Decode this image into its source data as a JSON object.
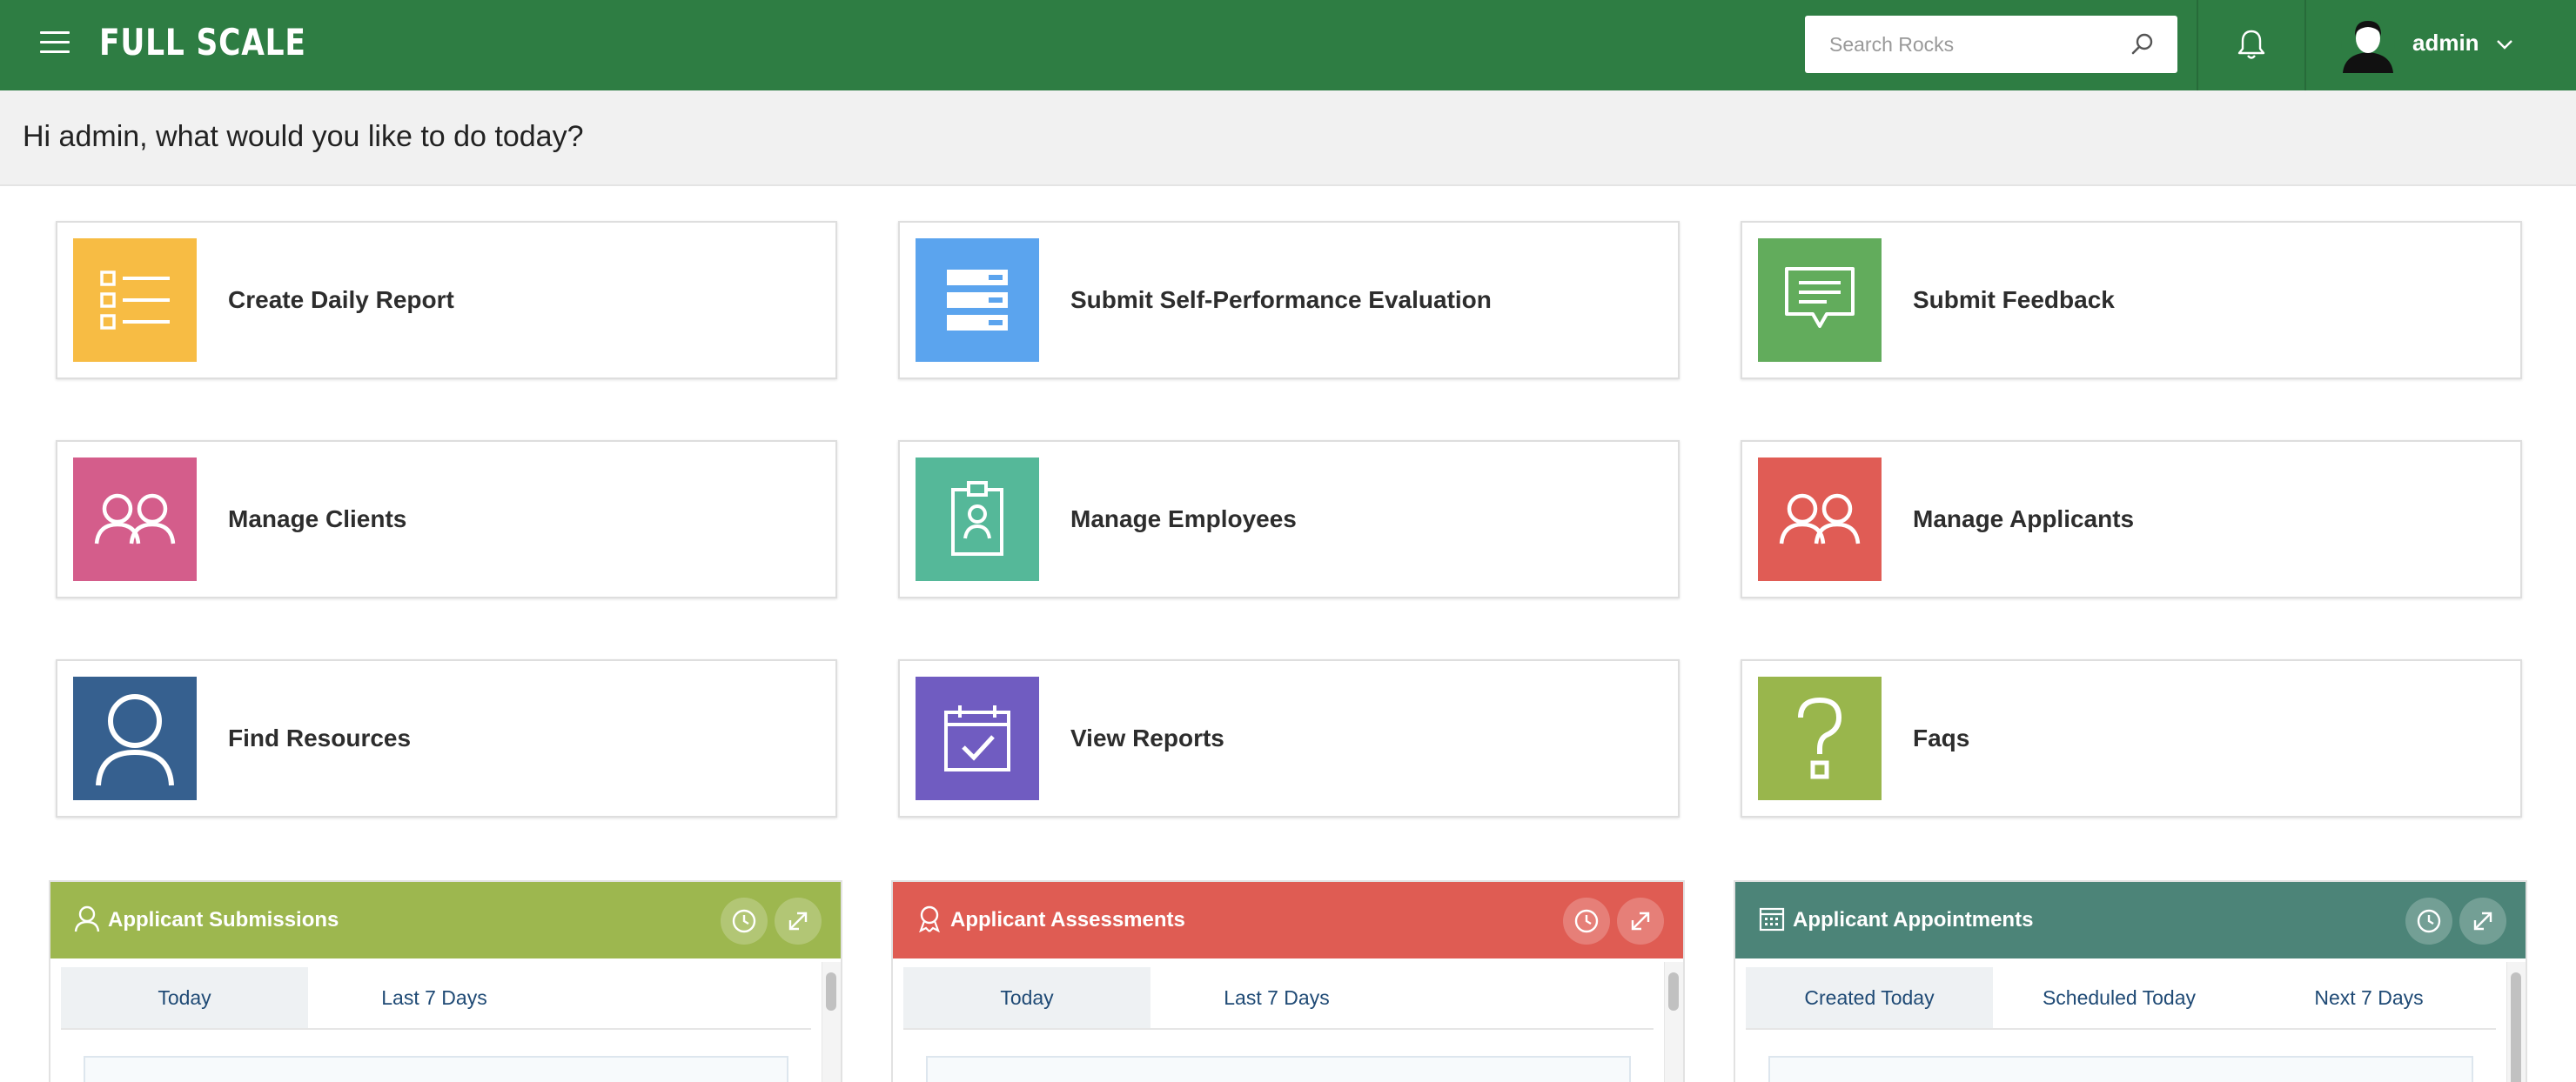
{
  "header": {
    "logo": "FULL SCALE",
    "search_placeholder": "Search Rocks",
    "user_name": "admin",
    "icons": {
      "menu": "hamburger-icon",
      "search": "search-icon",
      "notifications": "bell-icon",
      "account": "chevron-down-icon"
    }
  },
  "greeting": "Hi admin, what would you like to do today?",
  "cards": [
    {
      "label": "Create Daily Report",
      "color": "#f7bc44",
      "icon": "list-icon"
    },
    {
      "label": "Submit Self-Performance Evaluation",
      "color": "#5ba4ee",
      "icon": "form-icon"
    },
    {
      "label": "Submit Feedback",
      "color": "#62ac5c",
      "icon": "chat-icon"
    },
    {
      "label": "Manage Clients",
      "color": "#d45d8b",
      "icon": "users-icon"
    },
    {
      "label": "Manage Employees",
      "color": "#55b899",
      "icon": "badge-icon"
    },
    {
      "label": "Manage Applicants",
      "color": "#e05c55",
      "icon": "users-icon"
    },
    {
      "label": "Find Resources",
      "color": "#36608f",
      "icon": "person-icon"
    },
    {
      "label": "View Reports",
      "color": "#705cc1",
      "icon": "calendar-check-icon"
    },
    {
      "label": "Faqs",
      "color": "#99b64c",
      "icon": "question-icon"
    }
  ],
  "widgets": [
    {
      "title": "Applicant Submissions",
      "color": "#9db74f",
      "icon": "person-icon",
      "tabs": [
        "Today",
        "Last 7 Days"
      ],
      "active_tab": "Today"
    },
    {
      "title": "Applicant Assessments",
      "color": "#df5c53",
      "icon": "award-icon",
      "tabs": [
        "Today",
        "Last 7 Days"
      ],
      "active_tab": "Today"
    },
    {
      "title": "Applicant Appointments",
      "color": "#4c8478",
      "icon": "calendar-icon",
      "tabs": [
        "Created Today",
        "Scheduled Today",
        "Next 7 Days"
      ],
      "active_tab": "Created Today"
    }
  ]
}
